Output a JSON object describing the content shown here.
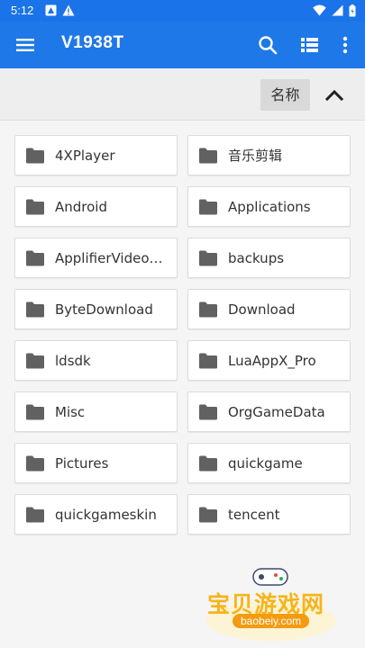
{
  "status_bar": {
    "time": "5:12",
    "left_icons": [
      "app-notification-icon",
      "warning-icon"
    ],
    "right_icons": [
      "wifi-icon",
      "signal-icon",
      "battery-icon"
    ]
  },
  "app_bar": {
    "title": "V1938T",
    "actions": [
      "search-icon",
      "list-view-icon",
      "more-options-icon"
    ]
  },
  "sort_bar": {
    "sort_label": "名称",
    "sort_direction_icon": "chevron-up-icon"
  },
  "folders": [
    {
      "name": "4XPlayer"
    },
    {
      "name": "音乐剪辑"
    },
    {
      "name": "Android"
    },
    {
      "name": "Applications"
    },
    {
      "name": "ApplifierVideoCa..."
    },
    {
      "name": "backups"
    },
    {
      "name": "ByteDownload"
    },
    {
      "name": "Download"
    },
    {
      "name": "ldsdk"
    },
    {
      "name": "LuaAppX_Pro"
    },
    {
      "name": "Misc"
    },
    {
      "name": "OrgGameData"
    },
    {
      "name": "Pictures"
    },
    {
      "name": "quickgame"
    },
    {
      "name": "quickgameskin"
    },
    {
      "name": "tencent"
    }
  ],
  "watermark": {
    "text": "宝贝游戏网",
    "url": "baobeiy.com"
  },
  "colors": {
    "primary": "#1f78e8",
    "folder_icon": "#616161",
    "background": "#f5f5f5"
  }
}
